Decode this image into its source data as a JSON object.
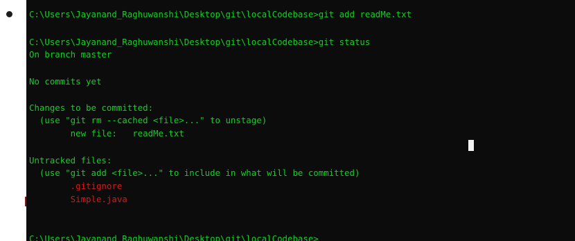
{
  "terminal": {
    "lines": [
      "C:\\Users\\Jayanand_Raghuwanshi\\Desktop\\git\\localCodebase>git add readMe.txt",
      "",
      "C:\\Users\\Jayanand_Raghuwanshi\\Desktop\\git\\localCodebase>git status",
      "On branch master",
      "",
      "No commits yet",
      "",
      "Changes to be committed:",
      "  (use \"git rm --cached <file>...\" to unstage)",
      "        new file:   readMe.txt",
      "",
      "Untracked files:",
      "  (use \"git add <file>...\" to include in what will be committed)",
      "        .gitignore",
      "        Simple.java",
      "",
      "",
      "C:\\Users\\Jayanand_Raghuwanshi\\Desktop\\git\\localCodebase>"
    ]
  },
  "colors": {
    "background": "#0c0c0c",
    "text_green": "#13ce25",
    "text_red": "#d21b1b",
    "cursor": "#f2f2f2"
  }
}
